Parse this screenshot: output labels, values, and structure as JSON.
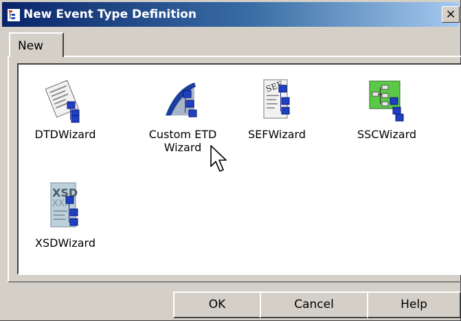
{
  "window": {
    "title": "New Event Type Definition",
    "close_glyph": "×"
  },
  "tabs": [
    {
      "label": "New",
      "selected": true
    }
  ],
  "items": [
    {
      "label": "DTDWizard",
      "icon": "dtd-document-icon"
    },
    {
      "label": "Custom ETD\nWizard",
      "icon": "custom-etd-icon"
    },
    {
      "label": "SEFWizard",
      "icon": "sef-document-icon"
    },
    {
      "label": "SSCWizard",
      "icon": "ssc-tree-icon"
    },
    {
      "label": "XSDWizard",
      "icon": "xsd-document-icon"
    }
  ],
  "buttons": {
    "ok": "OK",
    "cancel": "Cancel",
    "help": "Help"
  },
  "colors": {
    "titlebar_start": "#0a246a",
    "titlebar_end": "#a6caf0",
    "dialog_face": "#d4d0c8",
    "node_blue": "#1f3fc4",
    "ssc_green": "#5cc847"
  }
}
